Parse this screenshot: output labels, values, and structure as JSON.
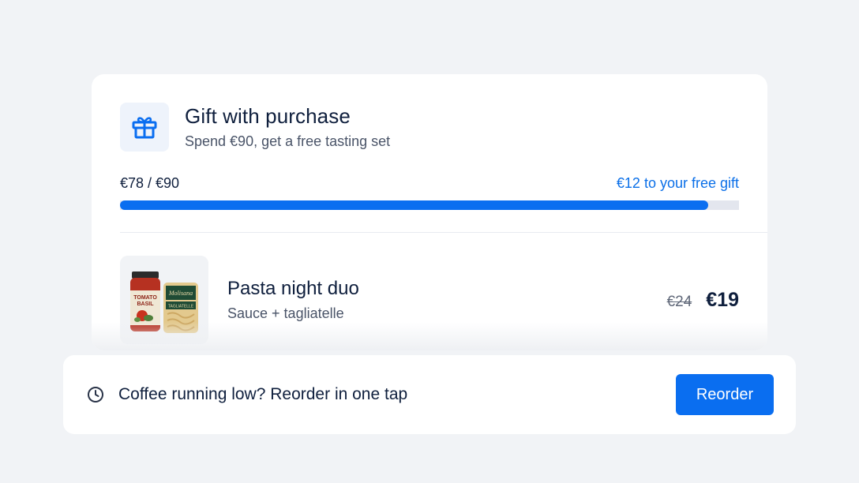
{
  "colors": {
    "accent": "#0a6ef0",
    "accent_text": "#0a6fe8",
    "page_background": "#f1f3f6",
    "card_background": "#ffffff",
    "progress_track": "#e3e6ee",
    "text_primary": "#0f1f3d",
    "text_secondary": "#4a5468"
  },
  "gift": {
    "icon": "gift-icon",
    "title": "Gift with purchase",
    "subtitle": "Spend €90, get a free tasting set"
  },
  "progress": {
    "current_label": "€78 / €90",
    "remaining_label": "€12 to your free gift",
    "current": 78,
    "target": 90,
    "fraction": 0.95
  },
  "product": {
    "name": "Pasta night duo",
    "description": "Sauce + tagliatelle",
    "price_old": "€24",
    "price_new": "€19",
    "image": {
      "jar_label_line1": "TOMATO",
      "jar_label_line2": "BASIL",
      "pasta_label": "TAGLIATELLE"
    }
  },
  "reorder": {
    "icon": "clock-icon",
    "message": "Coffee running low? Reorder in one tap",
    "button_label": "Reorder"
  }
}
